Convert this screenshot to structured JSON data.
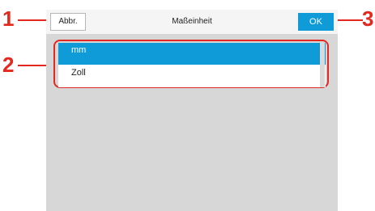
{
  "header": {
    "cancel_label": "Abbr.",
    "title": "Maßeinheit",
    "ok_label": "OK"
  },
  "unit_list": {
    "items": [
      {
        "label": "mm",
        "selected": true
      },
      {
        "label": "Zoll",
        "selected": false
      }
    ]
  },
  "callouts": [
    "1",
    "2",
    "3"
  ],
  "colors": {
    "accent": "#0f9bd7",
    "callout": "#e3281f",
    "panel_background": "#d7d7d7"
  }
}
